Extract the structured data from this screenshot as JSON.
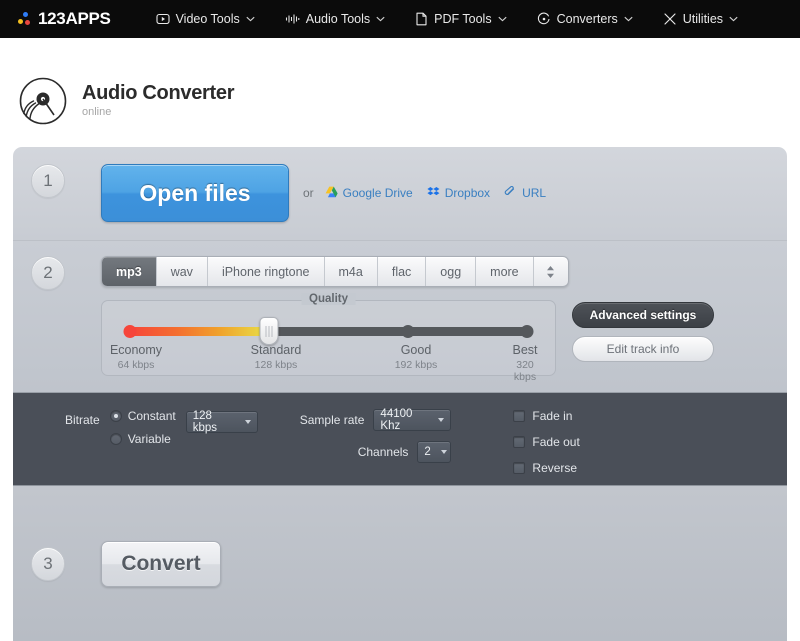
{
  "nav": {
    "logo_text": "123APPS",
    "items": [
      {
        "label": "Video Tools",
        "icon": "video-play-icon"
      },
      {
        "label": "Audio Tools",
        "icon": "audio-waveform-icon"
      },
      {
        "label": "PDF Tools",
        "icon": "document-icon"
      },
      {
        "label": "Converters",
        "icon": "refresh-circle-icon"
      },
      {
        "label": "Utilities",
        "icon": "tools-icon"
      }
    ]
  },
  "header": {
    "title": "Audio Converter",
    "subtitle": "online",
    "icon": "vinyl-record-icon"
  },
  "step1": {
    "number": "1",
    "open_files_label": "Open files",
    "or_label": "or",
    "cloud_links": [
      {
        "label": "Google Drive",
        "icon": "google-drive-icon"
      },
      {
        "label": "Dropbox",
        "icon": "dropbox-icon"
      },
      {
        "label": "URL",
        "icon": "link-icon"
      }
    ]
  },
  "step2": {
    "number": "2",
    "formats": [
      {
        "label": "mp3",
        "active": true
      },
      {
        "label": "wav",
        "active": false
      },
      {
        "label": "iPhone ringtone",
        "active": false
      },
      {
        "label": "m4a",
        "active": false
      },
      {
        "label": "flac",
        "active": false
      },
      {
        "label": "ogg",
        "active": false
      },
      {
        "label": "more",
        "active": false
      }
    ],
    "quality": {
      "title": "Quality",
      "selected_index": 1,
      "stops": [
        {
          "name": "Economy",
          "bitrate": "64 kbps"
        },
        {
          "name": "Standard",
          "bitrate": "128 kbps"
        },
        {
          "name": "Good",
          "bitrate": "192 kbps"
        },
        {
          "name": "Best",
          "bitrate": "320 kbps"
        }
      ]
    },
    "advanced_settings_label": "Advanced settings",
    "edit_track_info_label": "Edit track info"
  },
  "advanced": {
    "bitrate_label": "Bitrate",
    "constant_label": "Constant",
    "variable_label": "Variable",
    "bitrate_value": "128 kbps",
    "sample_rate_label": "Sample rate",
    "sample_rate_value": "44100 Khz",
    "channels_label": "Channels",
    "channels_value": "2",
    "fade_in_label": "Fade in",
    "fade_out_label": "Fade out",
    "reverse_label": "Reverse"
  },
  "step3": {
    "number": "3",
    "convert_label": "Convert"
  },
  "colors": {
    "accent_blue": "#4ea3e4",
    "link_blue": "#3a7fc1",
    "dark_panel": "#4a4f58",
    "quality_low": "#f6453a"
  }
}
